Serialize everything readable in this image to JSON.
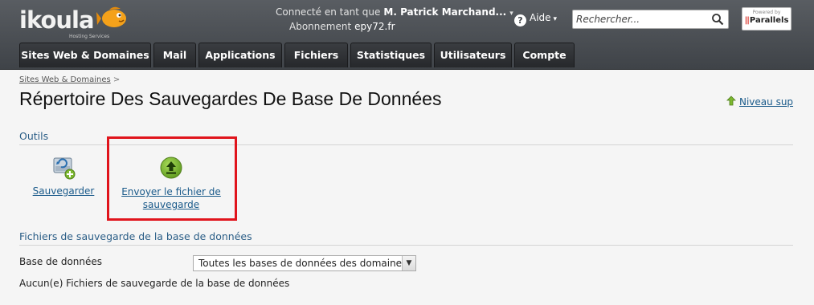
{
  "header": {
    "logo": "ikoula",
    "logo_sub": "Hosting Services",
    "connected_label": "Connecté en tant que",
    "user_name": "M. Patrick Marchand...",
    "subscription_label": "Abonnement",
    "subscription_value": "epy72.fr",
    "help_label": "Aide",
    "search_placeholder": "Rechercher...",
    "powered_by": "Powered by",
    "parallels": "Parallels"
  },
  "tabs": [
    {
      "label": "Sites Web & Domaines"
    },
    {
      "label": "Mail"
    },
    {
      "label": "Applications"
    },
    {
      "label": "Fichiers"
    },
    {
      "label": "Statistiques"
    },
    {
      "label": "Utilisateurs"
    },
    {
      "label": "Compte"
    }
  ],
  "breadcrumb": {
    "item": "Sites Web & Domaines",
    "sep": ">"
  },
  "page_title": "Répertoire Des Sauvegardes De Base De Données",
  "up_level": "Niveau sup",
  "tools": {
    "title": "Outils",
    "backup_label": "Sauvegarder",
    "upload_line1": "Envoyer le fichier de",
    "upload_line2": "sauvegarde"
  },
  "files": {
    "title": "Fichiers de sauvegarde de la base de données",
    "db_label": "Base de données",
    "db_select": "Toutes les bases de données des domaines",
    "empty": "Aucun(e) Fichiers de sauvegarde de la base de données"
  },
  "colors": {
    "header_bg": "#4a4e53",
    "tab_bg": "#2e3033",
    "link": "#1a5a8a",
    "section_title": "#2a5d86",
    "highlight": "#e0141c",
    "upload_icon": "#7cb82f"
  },
  "icons": [
    "fish-logo-icon",
    "help-icon",
    "search-icon",
    "parallels-logo",
    "up-level-icon",
    "database-backup-icon",
    "upload-icon",
    "dropdown-arrow-icon"
  ]
}
